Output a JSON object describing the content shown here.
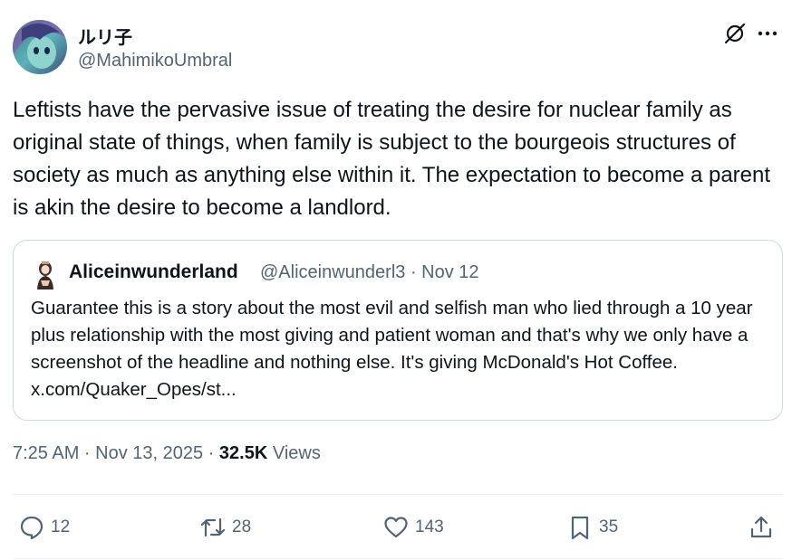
{
  "author": {
    "display_name": "ルリ子",
    "handle": "@MahimikoUmbral",
    "avatar_icon": "avatar-image"
  },
  "header_icons": {
    "grok": "grok-icon",
    "more": "more-icon"
  },
  "tweet": {
    "text": "Leftists have the pervasive issue of treating the desire for nuclear family as original state of things, when family is subject to the bourgeois structures of society as much as anything else within it. The expectation to become a parent is akin the desire to become a landlord."
  },
  "quote": {
    "display_name": "Aliceinwunderland",
    "meta": "@Aliceinwunderl3 · Nov 12",
    "text": "Guarantee this is a story about the most evil and selfish man who lied through a 10 year plus relationship with the most giving and patient woman and that's why we only have a screenshot of the headline and nothing else. It's giving McDonald's Hot Coffee. x.com/Quaker_Opes/st..."
  },
  "meta": {
    "time": "7:25 AM · Nov 13, 2025 · ",
    "views_count": "32.5K",
    "views_label": " Views"
  },
  "actions": {
    "replies": "12",
    "reposts": "28",
    "likes": "143",
    "bookmarks": "35"
  },
  "colors": {
    "text": "#0f1419",
    "secondary": "#536471",
    "border": "#cfd9de"
  }
}
